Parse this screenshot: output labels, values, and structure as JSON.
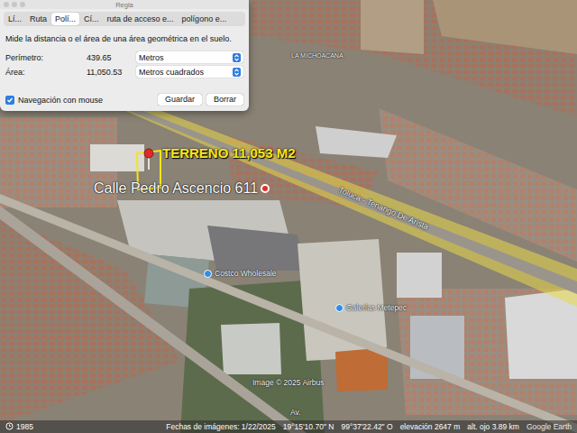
{
  "window": {
    "title": "Regla"
  },
  "tabs": [
    {
      "label": "Lí...",
      "selected": false
    },
    {
      "label": "Ruta",
      "selected": false
    },
    {
      "label": "Polí...",
      "selected": true
    },
    {
      "label": "Cí...",
      "selected": false
    },
    {
      "label": "ruta de acceso e...",
      "selected": false
    },
    {
      "label": "polígono e...",
      "selected": false
    }
  ],
  "description": "Mide la distancia o el área de una área geométrica en el suelo.",
  "measurements": [
    {
      "label": "Perímetro:",
      "value": "439.65",
      "unit": "Metros"
    },
    {
      "label": "Área:",
      "value": "11,050.53",
      "unit": "Metros cuadrados"
    }
  ],
  "mouse_navigation": {
    "label": "Navegación con mouse",
    "checked": true
  },
  "buttons": [
    "Guardar",
    "Borrar"
  ],
  "map": {
    "labels": [
      {
        "text": "TERRENO 11,053 M2",
        "kind": "title"
      },
      {
        "text": "Calle Pedro Ascencio 611",
        "kind": "marker"
      },
      {
        "text": "LA MICHOACANA",
        "kind": "small"
      },
      {
        "text": "Toluca - Tenango De Arista",
        "kind": "road"
      },
      {
        "text": "Costco Wholesale",
        "kind": "poi"
      },
      {
        "text": "Galerías Metepec",
        "kind": "poi"
      },
      {
        "text": "Av.",
        "kind": "place"
      },
      {
        "text": "Image © 2025 Airbus",
        "kind": "credit"
      }
    ]
  },
  "status_bar": {
    "history": "1985",
    "imagery_date": "Fechas de imágenes: 1/22/2025",
    "latitude": "19°15'10.70\" N",
    "longitude": "99°37'22.42\" O",
    "elevation": "elevación 2647 m",
    "eye_altitude": "alt. ojo 3.89 km",
    "brand": "Google Earth"
  }
}
